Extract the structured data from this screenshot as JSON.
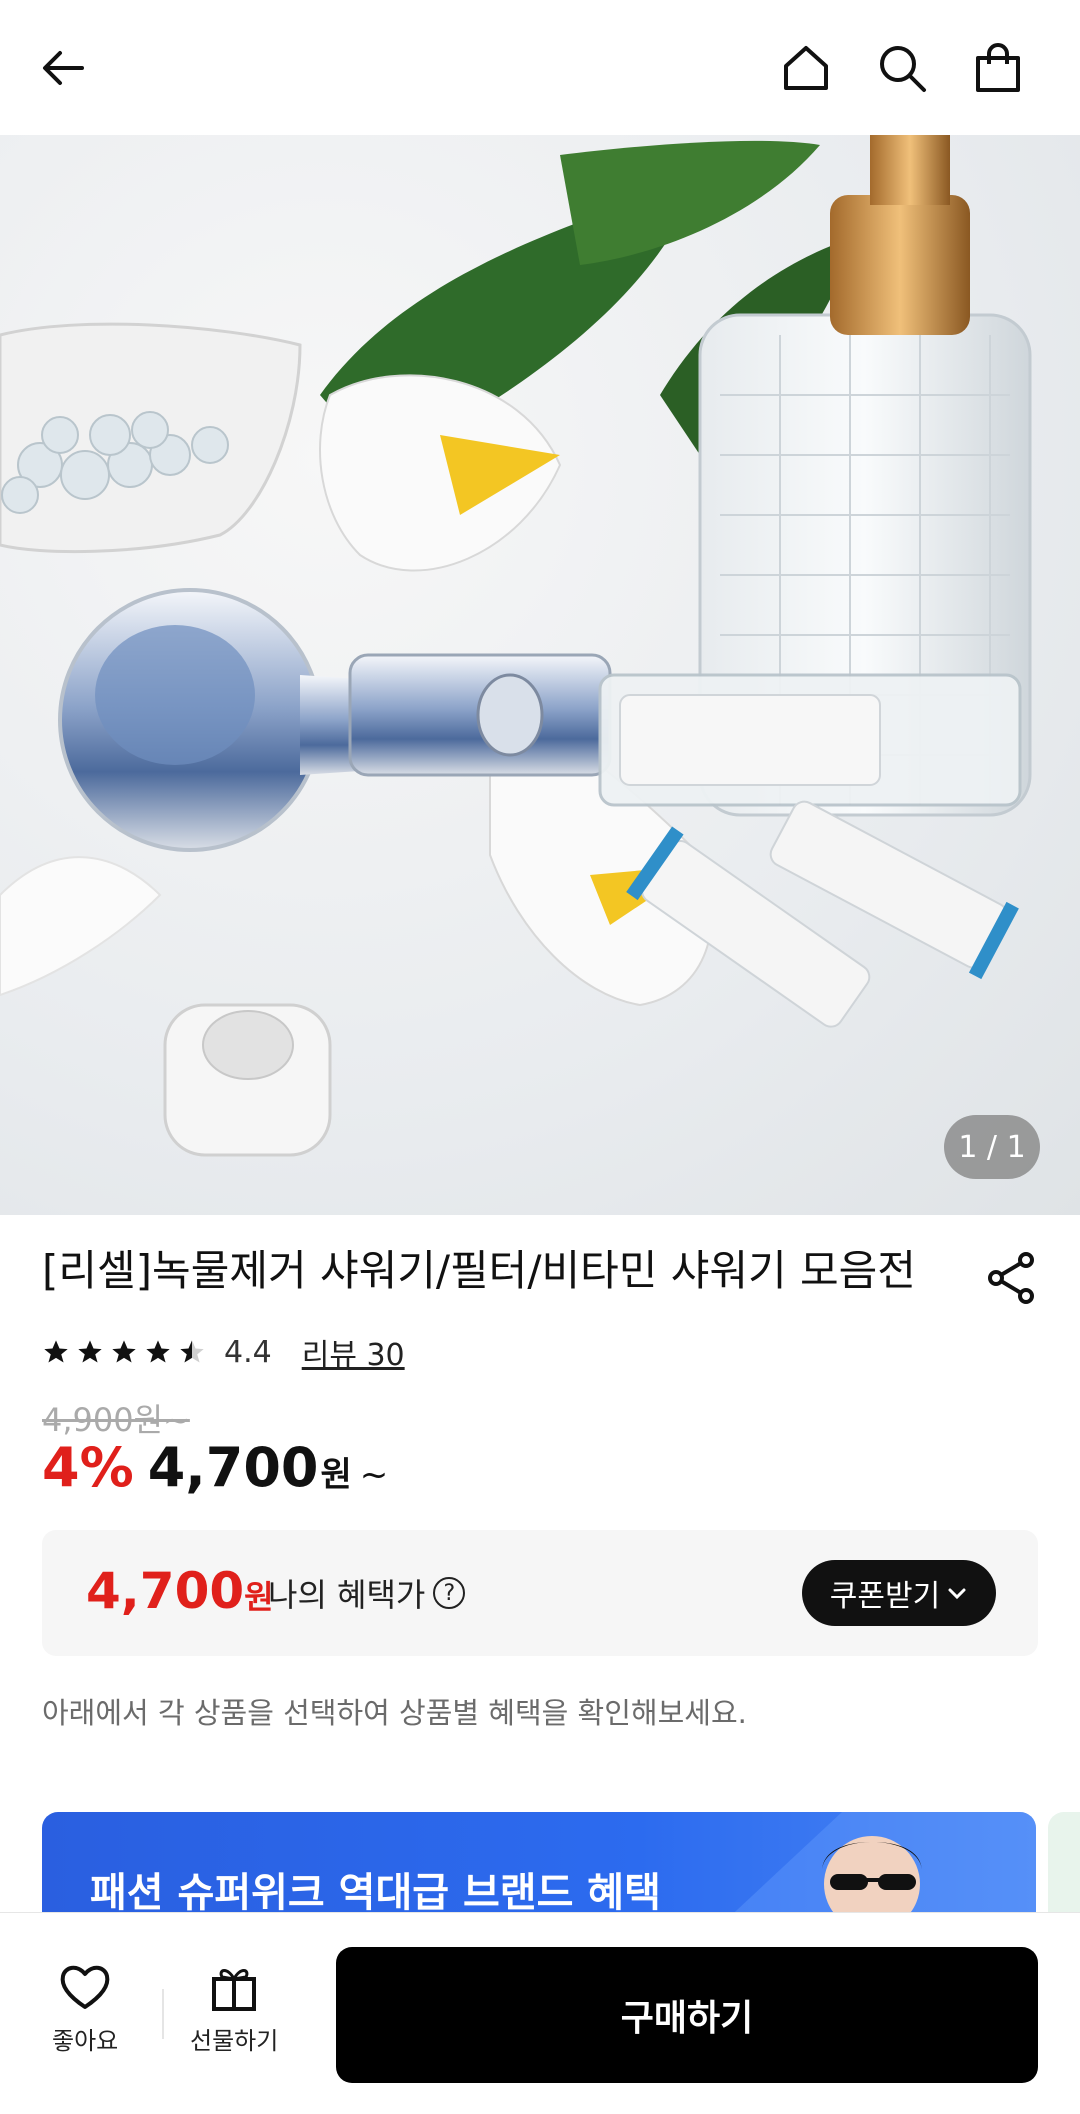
{
  "header": {
    "back_icon": "back-arrow-icon",
    "home_icon": "home-icon",
    "search_icon": "search-icon",
    "cart_icon": "shopping-bag-icon"
  },
  "gallery": {
    "pager": "1 / 1"
  },
  "product": {
    "title": "[리셀]녹물제거 샤워기/필터/비타민 샤워기 모음전",
    "rating": "4.4",
    "rating_stars": 4.4,
    "review_link": "리뷰 30",
    "original_price": "4,900원~",
    "discount": "4%",
    "price": "4,700",
    "won": "원",
    "tilde": "~"
  },
  "benefit": {
    "price": "4,700",
    "won": "원",
    "label": "나의 혜택가",
    "help": "?",
    "coupon_button": "쿠폰받기"
  },
  "notice": "아래에서 각 상품을 선택하여 상품별 혜택을 확인해보세요.",
  "banner": {
    "text": "패션 슈퍼위크 역대급 브랜드 혜택"
  },
  "bottom": {
    "like_label": "좋아요",
    "gift_label": "선물하기",
    "buy_label": "구매하기"
  },
  "colors": {
    "accent_red": "#e0201b",
    "banner_blue": "#2c6bef",
    "buy_black": "#000000"
  }
}
